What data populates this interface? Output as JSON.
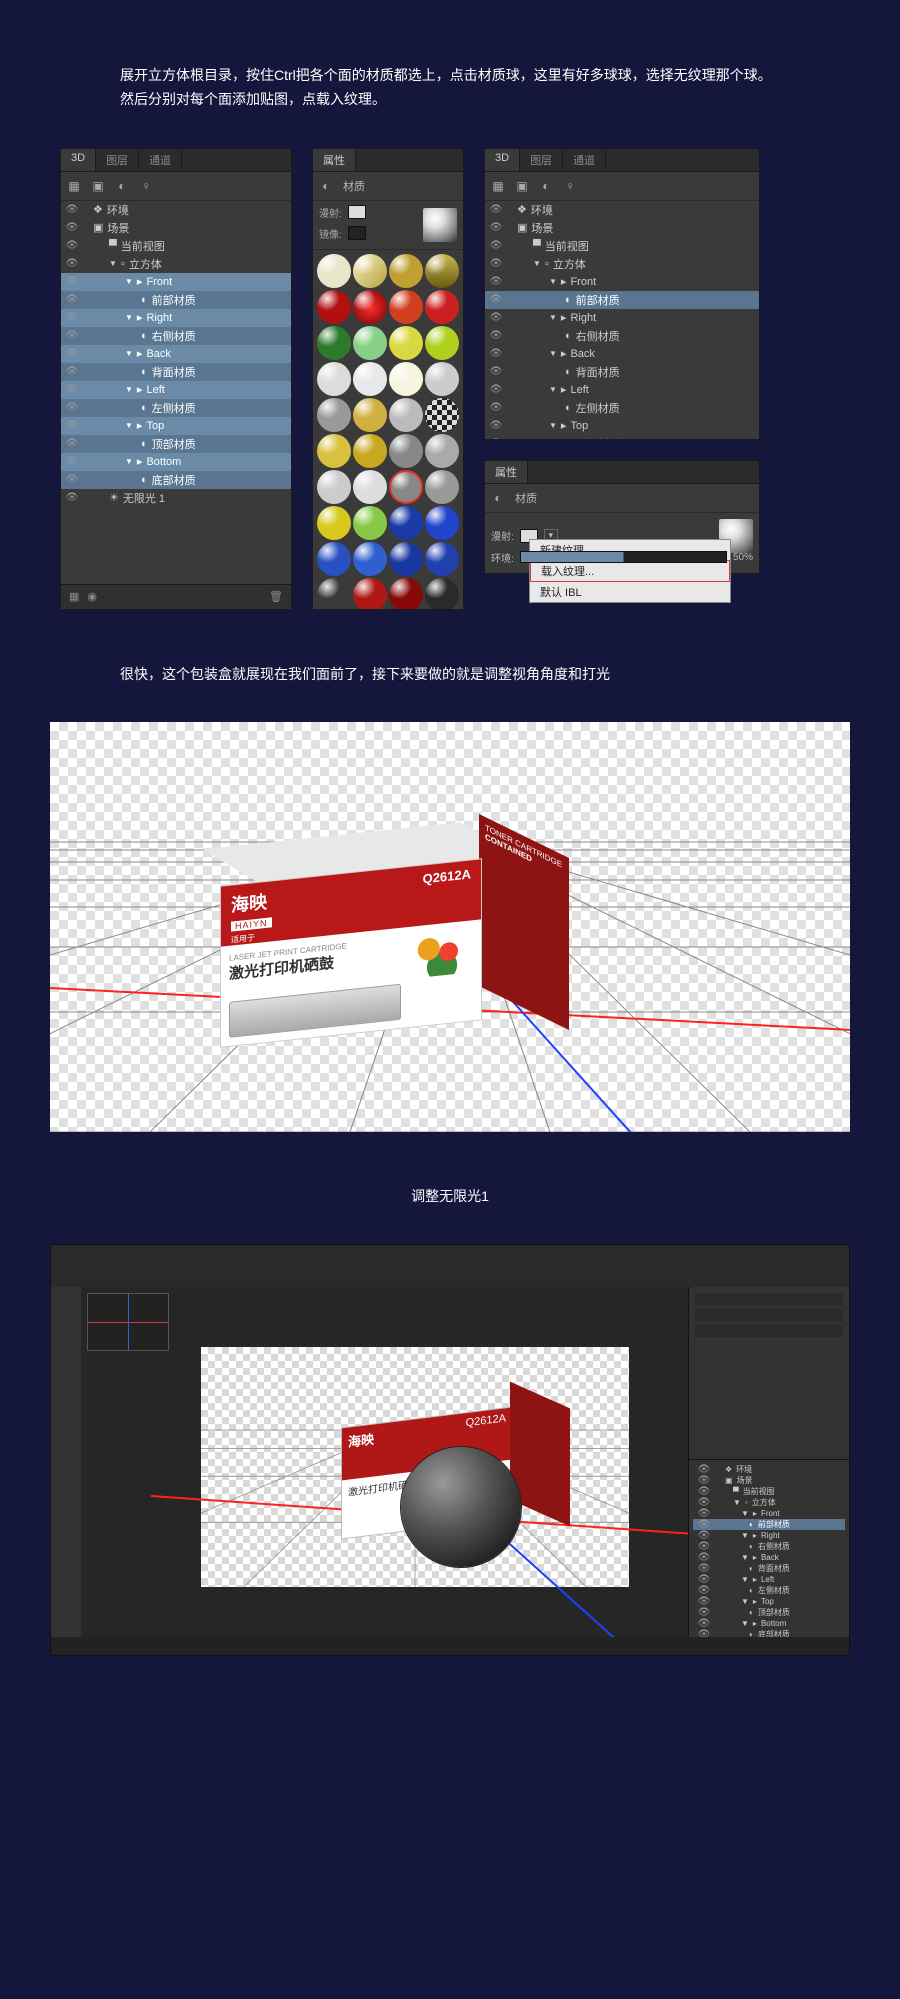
{
  "intro": "展开立方体根目录，按住Ctrl把各个面的材质都选上，点击材质球，这里有好多球球，选择无纹理那个球。然后分别对每个面添加贴图，点载入纹理。",
  "panel3d": {
    "tabs": [
      "3D",
      "图层",
      "通道"
    ],
    "tree": [
      {
        "icon": "env",
        "label": "环境",
        "depth": 1
      },
      {
        "icon": "scene",
        "label": "场景",
        "depth": 1
      },
      {
        "icon": "cam",
        "label": "当前视图",
        "depth": 2
      },
      {
        "icon": "mesh",
        "label": "立方体",
        "depth": 2,
        "caret": true
      },
      {
        "icon": "folder",
        "label": "Front",
        "depth": 3,
        "caret": true,
        "sel": true
      },
      {
        "icon": "mat",
        "label": "前部材质",
        "depth": 4,
        "sel": true,
        "sub": true
      },
      {
        "icon": "folder",
        "label": "Right",
        "depth": 3,
        "caret": true,
        "sel": true
      },
      {
        "icon": "mat",
        "label": "右侧材质",
        "depth": 4,
        "sel": true,
        "sub": true
      },
      {
        "icon": "folder",
        "label": "Back",
        "depth": 3,
        "caret": true,
        "sel": true
      },
      {
        "icon": "mat",
        "label": "背面材质",
        "depth": 4,
        "sel": true,
        "sub": true
      },
      {
        "icon": "folder",
        "label": "Left",
        "depth": 3,
        "caret": true,
        "sel": true
      },
      {
        "icon": "mat",
        "label": "左侧材质",
        "depth": 4,
        "sel": true,
        "sub": true
      },
      {
        "icon": "folder",
        "label": "Top",
        "depth": 3,
        "caret": true,
        "sel": true
      },
      {
        "icon": "mat",
        "label": "顶部材质",
        "depth": 4,
        "sel": true,
        "sub": true
      },
      {
        "icon": "folder",
        "label": "Bottom",
        "depth": 3,
        "caret": true,
        "sel": true
      },
      {
        "icon": "mat",
        "label": "底部材质",
        "depth": 4,
        "sel": true,
        "sub": true
      },
      {
        "icon": "light",
        "label": "无限光 1",
        "depth": 2
      }
    ]
  },
  "panel3d_right": {
    "tree": [
      {
        "icon": "env",
        "label": "环境",
        "depth": 1
      },
      {
        "icon": "scene",
        "label": "场景",
        "depth": 1
      },
      {
        "icon": "cam",
        "label": "当前视图",
        "depth": 2
      },
      {
        "icon": "mesh",
        "label": "立方体",
        "depth": 2,
        "caret": true
      },
      {
        "icon": "folder",
        "label": "Front",
        "depth": 3,
        "caret": true
      },
      {
        "icon": "mat",
        "label": "前部材质",
        "depth": 4,
        "sel": true,
        "sub": true
      },
      {
        "icon": "folder",
        "label": "Right",
        "depth": 3,
        "caret": true
      },
      {
        "icon": "mat",
        "label": "右侧材质",
        "depth": 4
      },
      {
        "icon": "folder",
        "label": "Back",
        "depth": 3,
        "caret": true
      },
      {
        "icon": "mat",
        "label": "背面材质",
        "depth": 4
      },
      {
        "icon": "folder",
        "label": "Left",
        "depth": 3,
        "caret": true
      },
      {
        "icon": "mat",
        "label": "左侧材质",
        "depth": 4
      },
      {
        "icon": "folder",
        "label": "Top",
        "depth": 3,
        "caret": true
      },
      {
        "icon": "mat",
        "label": "顶部材质",
        "depth": 4
      },
      {
        "icon": "folder",
        "label": "Bottom",
        "depth": 3,
        "caret": true
      },
      {
        "icon": "mat",
        "label": "底部材质",
        "depth": 4
      },
      {
        "icon": "light",
        "label": "无限光 1",
        "depth": 2
      }
    ]
  },
  "materials": {
    "tab": "属性",
    "header_label": "材质",
    "diffuse_label": "漫射:",
    "specular_label": "镜像:",
    "balls": [
      {
        "c": "#e8e5c8"
      },
      {
        "c": "linear-gradient(135deg,#f5f0c0,#b8a040)"
      },
      {
        "c": "#c0a030"
      },
      {
        "c": "linear-gradient(#c8b850,#6a5a10)"
      },
      {
        "c": "#b01010"
      },
      {
        "c": "radial-gradient(#ff3030,#700)"
      },
      {
        "c": "#d04020"
      },
      {
        "c": "#cc2020"
      },
      {
        "c": "#2d7a2d"
      },
      {
        "c": "#88d088"
      },
      {
        "c": "#d8d840"
      },
      {
        "c": "#b0d020"
      },
      {
        "c": "#dcdcdc"
      },
      {
        "c": "#e8e8e8"
      },
      {
        "c": "#f5f5e0"
      },
      {
        "c": "#cccccc"
      },
      {
        "c": "#999999"
      },
      {
        "c": "#d0b040"
      },
      {
        "c": "#bbbbbb"
      },
      {
        "checker": true
      },
      {
        "c": "#d8c040"
      },
      {
        "c": "#c8a820"
      },
      {
        "c": "#888"
      },
      {
        "c": "#aaa"
      },
      {
        "c": "#cccccc"
      },
      {
        "c": "#dddddd"
      },
      {
        "c": "#888",
        "ring": true
      },
      {
        "c": "#999"
      },
      {
        "c": "#d8c820"
      },
      {
        "c": "#88c848"
      },
      {
        "c": "#1a3aa8"
      },
      {
        "c": "#2244cc"
      },
      {
        "c": "#2850c0"
      },
      {
        "c": "#3060d0"
      },
      {
        "c": "#1838a0"
      },
      {
        "c": "#2040b0"
      },
      {
        "c": "#3a3a3a"
      },
      {
        "c": "#b01818"
      },
      {
        "c": "#880808"
      },
      {
        "c": "#2a2a2a"
      }
    ]
  },
  "props_panel": {
    "tab": "属性",
    "header_label": "材质",
    "diffuse_label": "漫射:",
    "menu": [
      "新建纹理...",
      "载入纹理...",
      "默认 IBL"
    ],
    "env_label": "环境:",
    "percent": "50%"
  },
  "caption2": "很快，这个包装盒就展现在我们面前了，接下来要做的就是调整视角角度和打光",
  "caption3": "调整无限光1",
  "box": {
    "brand_cn": "海映",
    "brand_en": "HAIYN",
    "applies": "适用于",
    "code": "Q2612A",
    "tag1": "TONER CARTRIDGE",
    "tag2": "CONTAINED",
    "sub_en": "LASER JET PRINT CARTRIDGE",
    "sub_cn": "激光打印机硒鼓"
  }
}
